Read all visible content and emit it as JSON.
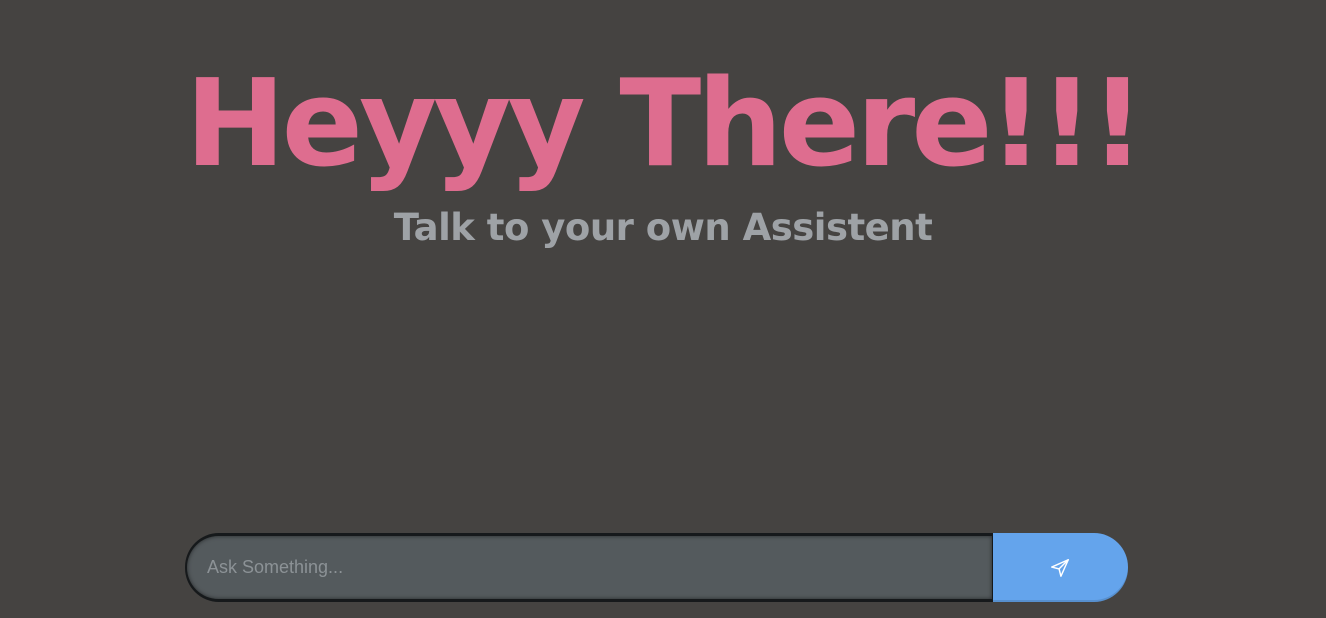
{
  "hero": {
    "title": "Heyyy There!!!",
    "subtitle": "Talk to your own Assistent"
  },
  "chat": {
    "input_placeholder": "Ask Something...",
    "input_value": "",
    "send_icon": "send-icon"
  },
  "colors": {
    "background": "#454341",
    "title": "#de6d8f",
    "subtitle": "#9ea2a6",
    "input": "#545a5d",
    "send_button": "#64a4ec"
  }
}
